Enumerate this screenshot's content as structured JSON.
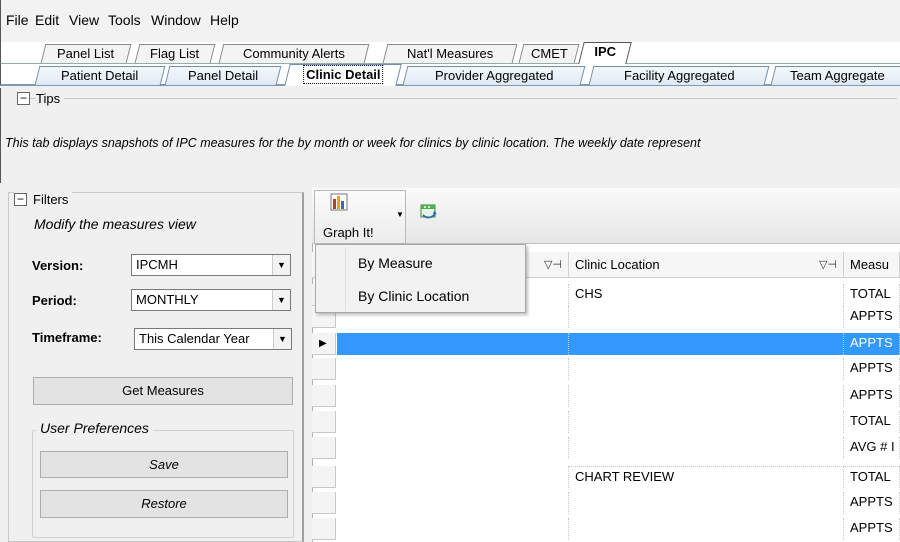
{
  "menubar": [
    "File",
    "Edit",
    "View",
    "Tools",
    "Window",
    "Help"
  ],
  "top_tabs": [
    {
      "label": "Panel List",
      "active": false
    },
    {
      "label": "Flag List",
      "active": false
    },
    {
      "label": "Community Alerts",
      "active": false
    },
    {
      "label": "Nat'l Measures",
      "active": false
    },
    {
      "label": "CMET",
      "active": false
    },
    {
      "label": "IPC",
      "active": true
    }
  ],
  "sub_tabs": [
    {
      "label": "Patient Detail",
      "active": false
    },
    {
      "label": "Panel Detail",
      "active": false
    },
    {
      "label": "Clinic Detail",
      "active": true
    },
    {
      "label": "Provider Aggregated",
      "active": false
    },
    {
      "label": "Facility Aggregated",
      "active": false
    },
    {
      "label": "Team Aggregate",
      "active": false
    }
  ],
  "tips": {
    "title": "Tips",
    "text": "This tab displays snapshots of IPC measures for the by month or week for clinics by clinic location.  The weekly date represent"
  },
  "filters": {
    "title": "Filters",
    "subtitle": "Modify the measures view",
    "version_label": "Version:",
    "version_value": "IPCMH",
    "period_label": "Period:",
    "period_value": "MONTHLY",
    "timeframe_label": "Timeframe:",
    "timeframe_value": "This Calendar Year",
    "get_measures": "Get Measures",
    "prefs_title": "User Preferences",
    "save": "Save",
    "restore": "Restore"
  },
  "toolbar": {
    "graph_label": "Graph It!"
  },
  "graph_menu": [
    "By Measure",
    "By Clinic Location"
  ],
  "grid": {
    "headers": [
      "Clinic Location",
      "Measu"
    ],
    "rows": [
      {
        "clinic": "CHS",
        "measure": "TOTAL",
        "selected": false
      },
      {
        "clinic": "",
        "measure": "APPTS",
        "selected": false
      },
      {
        "clinic": "",
        "measure": "APPTS",
        "selected": true
      },
      {
        "clinic": "",
        "measure": "APPTS",
        "selected": false
      },
      {
        "clinic": "",
        "measure": "APPTS",
        "selected": false
      },
      {
        "clinic": "",
        "measure": "TOTAL",
        "selected": false
      },
      {
        "clinic": "",
        "measure": "AVG # I",
        "selected": false
      },
      {
        "clinic": "CHART REVIEW",
        "measure": "TOTAL",
        "selected": false
      },
      {
        "clinic": "",
        "measure": "APPTS",
        "selected": false
      },
      {
        "clinic": "",
        "measure": "APPTS",
        "selected": false
      }
    ]
  },
  "colors": {
    "selection": "#3399ff",
    "tab_border": "#6e8fb3"
  }
}
